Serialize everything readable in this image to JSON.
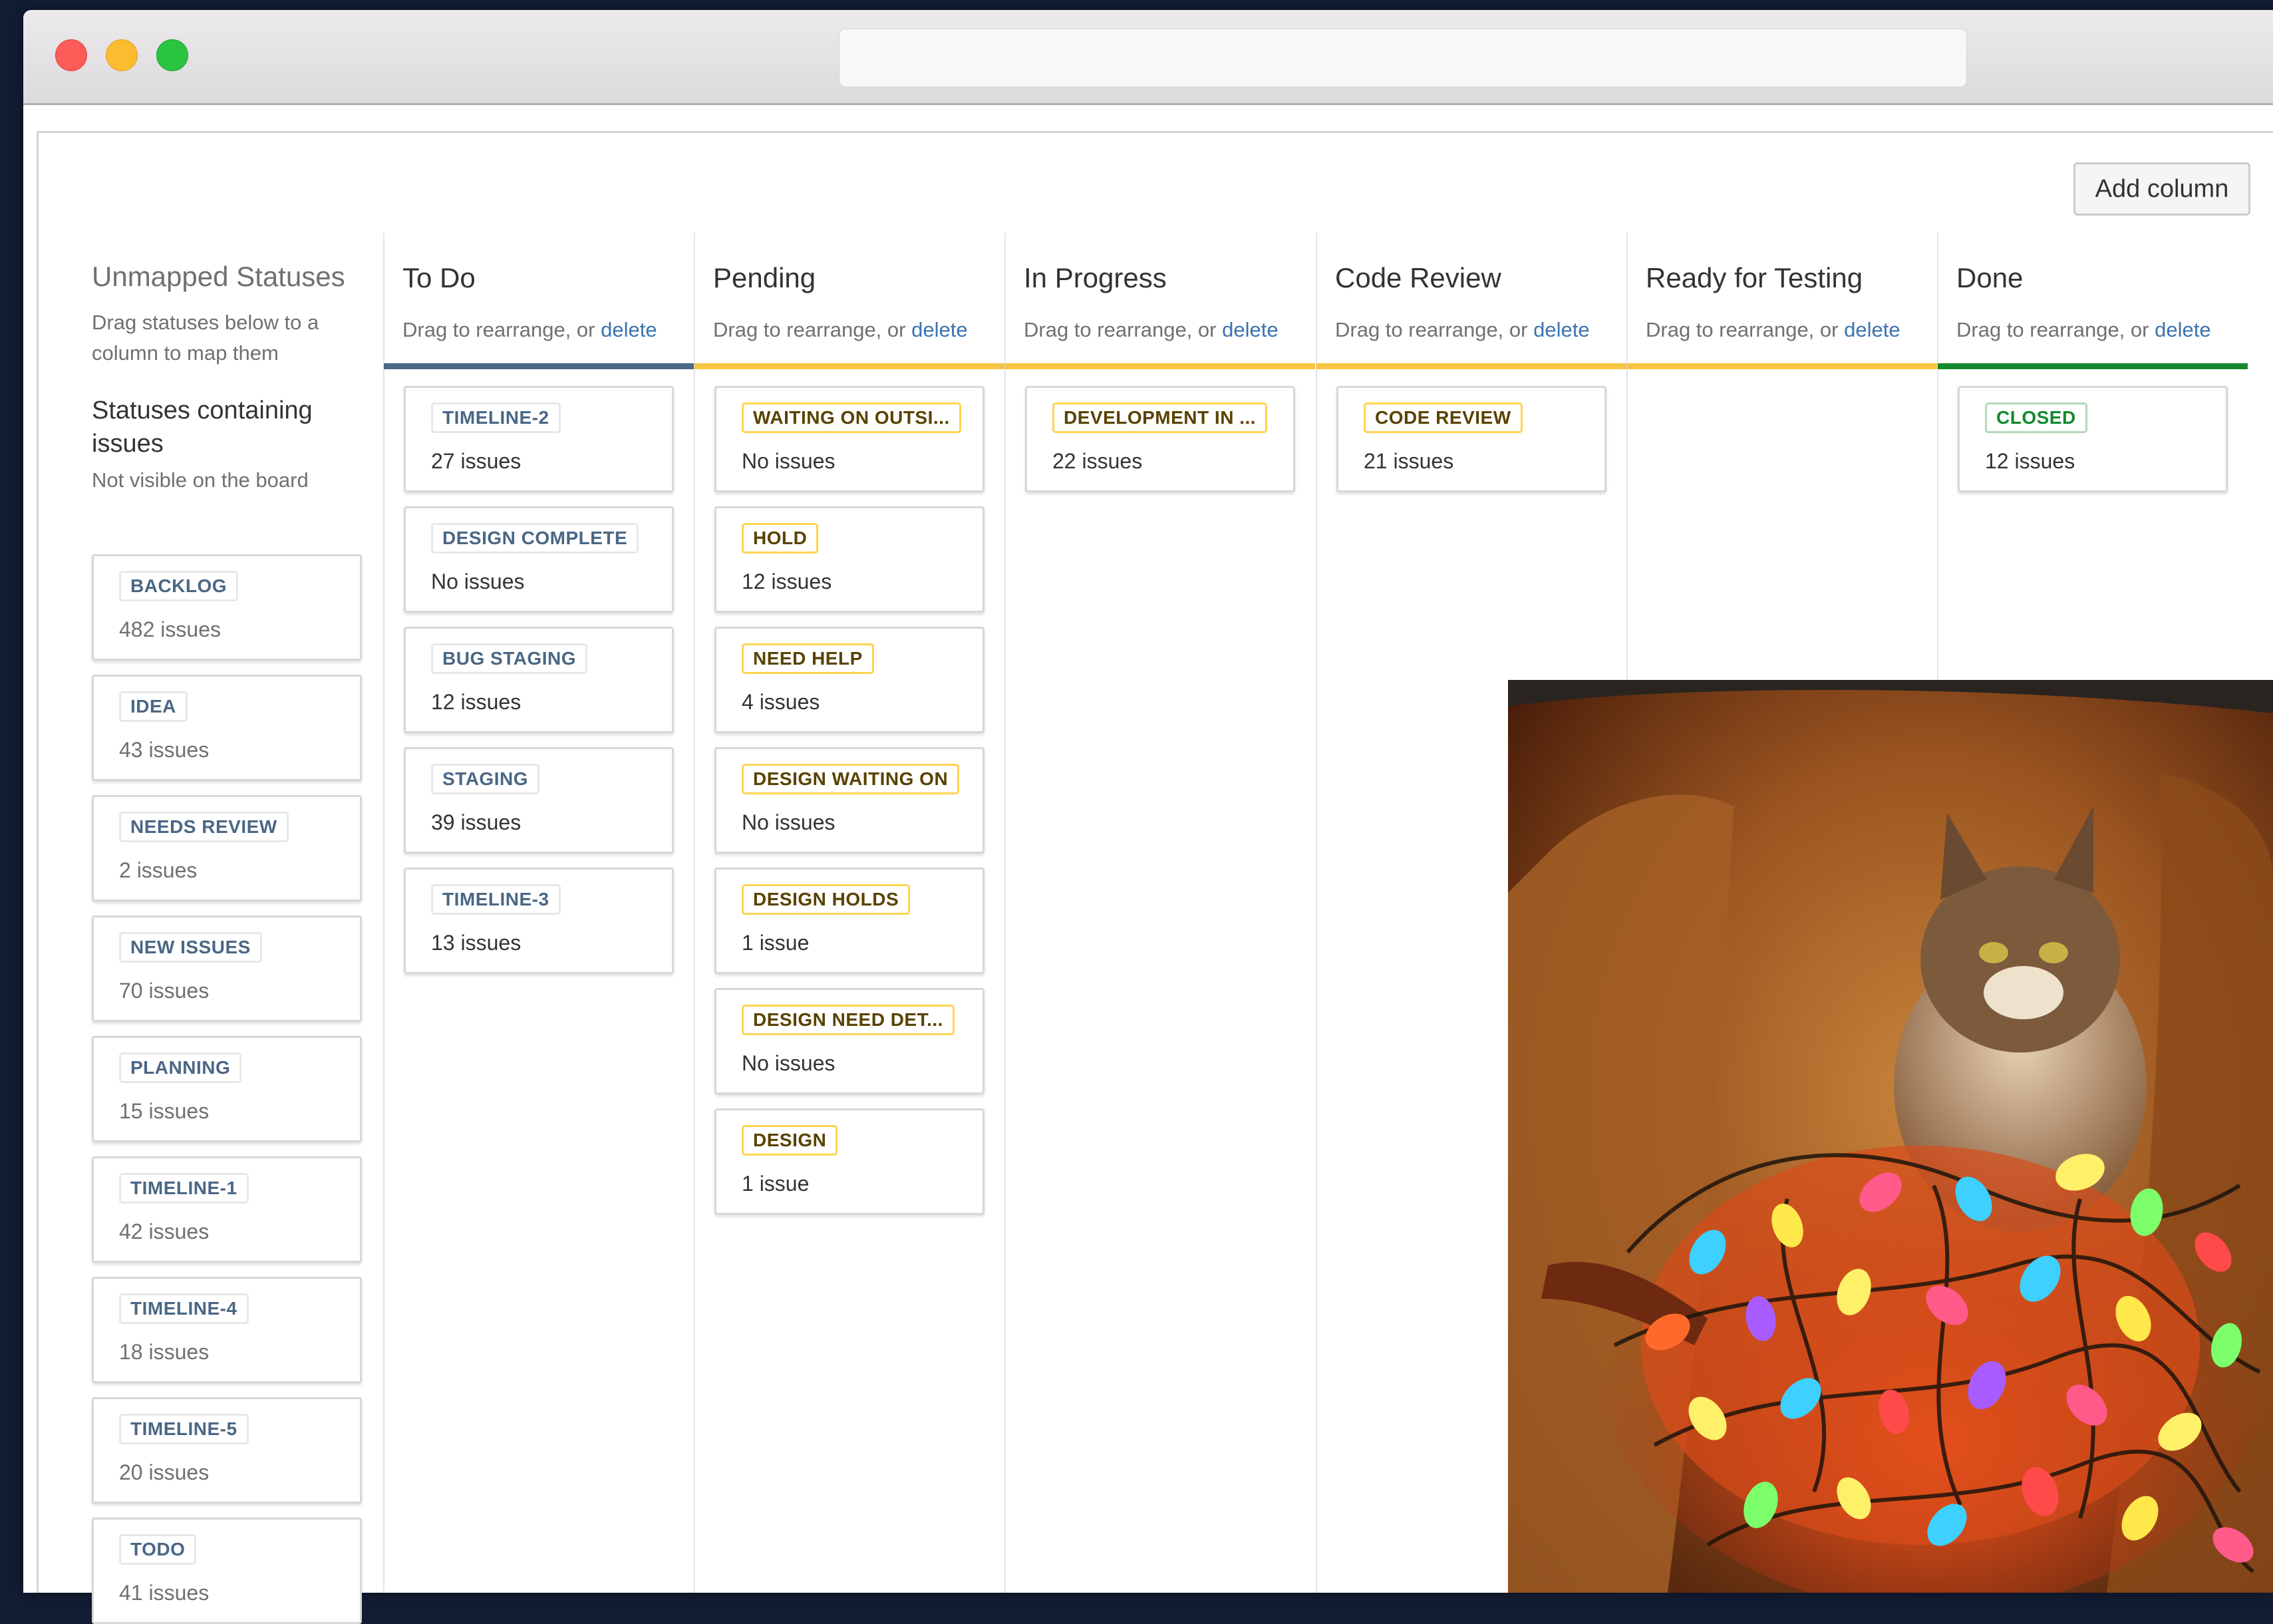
{
  "header": {
    "add_column": "Add column"
  },
  "unmapped": {
    "title": "Unmapped Statuses",
    "description": "Drag statuses below to a column to map them",
    "subtitle": "Statuses containing issues",
    "note": "Not visible on the board",
    "statuses": [
      {
        "name": "BACKLOG",
        "count": "482 issues"
      },
      {
        "name": "IDEA",
        "count": "43 issues"
      },
      {
        "name": "NEEDS REVIEW",
        "count": "2 issues"
      },
      {
        "name": "NEW ISSUES",
        "count": "70 issues"
      },
      {
        "name": "PLANNING",
        "count": "15 issues"
      },
      {
        "name": "TIMELINE-1",
        "count": "42 issues"
      },
      {
        "name": "TIMELINE-4",
        "count": "18 issues"
      },
      {
        "name": "TIMELINE-5",
        "count": "20 issues"
      },
      {
        "name": "TODO",
        "count": "41 issues"
      }
    ]
  },
  "columns": [
    {
      "title": "To Do",
      "desc": "Drag to rearrange, or",
      "delete": "delete",
      "color": "#4a6785",
      "statuses": [
        {
          "name": "TIMELINE-2",
          "count": "27 issues"
        },
        {
          "name": "DESIGN COMPLETE",
          "count": "No issues"
        },
        {
          "name": "BUG STAGING",
          "count": "12 issues"
        },
        {
          "name": "STAGING",
          "count": "39 issues"
        },
        {
          "name": "TIMELINE-3",
          "count": "13 issues"
        }
      ]
    },
    {
      "title": "Pending",
      "desc": "Drag to rearrange, or",
      "delete": "delete",
      "color": "#f6c342",
      "statuses": [
        {
          "name": "WAITING ON OUTSI...",
          "count": "No issues"
        },
        {
          "name": "HOLD",
          "count": "12 issues"
        },
        {
          "name": "NEED HELP",
          "count": "4 issues"
        },
        {
          "name": "DESIGN WAITING ON",
          "count": "No issues"
        },
        {
          "name": "DESIGN HOLDS",
          "count": "1 issue"
        },
        {
          "name": "DESIGN NEED DET...",
          "count": "No issues"
        },
        {
          "name": "DESIGN",
          "count": "1 issue"
        }
      ]
    },
    {
      "title": "In Progress",
      "desc": "Drag to rearrange, or",
      "delete": "delete",
      "color": "#f6c342",
      "statuses": [
        {
          "name": "DEVELOPMENT IN ...",
          "count": "22 issues"
        }
      ]
    },
    {
      "title": "Code Review",
      "desc": "Drag to rearrange, or",
      "delete": "delete",
      "color": "#f6c342",
      "statuses": [
        {
          "name": "CODE REVIEW",
          "count": "21 issues"
        }
      ]
    },
    {
      "title": "Ready for Testing",
      "desc": "Drag to rearrange, or",
      "delete": "delete",
      "color": "#f6c342",
      "statuses": []
    },
    {
      "title": "Done",
      "desc": "Drag to rearrange, or",
      "delete": "delete",
      "color": "#14892c",
      "statuses": [
        {
          "name": "CLOSED",
          "count": "12 issues"
        }
      ]
    }
  ]
}
